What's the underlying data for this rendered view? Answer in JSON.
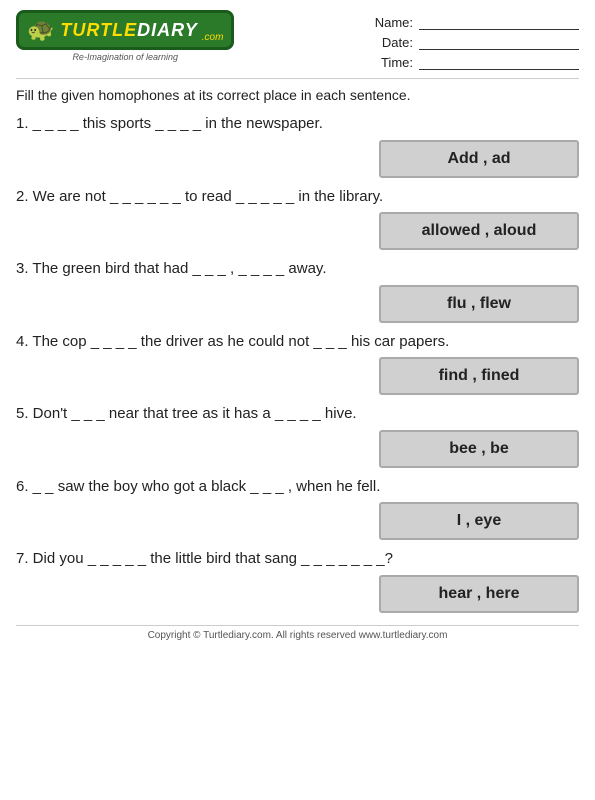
{
  "header": {
    "logo_turtle": "TURTLE",
    "logo_diary": "DIARY",
    "logo_com": ".com",
    "tagline": "Re-Imagination of learning",
    "name_label": "Name:",
    "date_label": "Date:",
    "time_label": "Time:"
  },
  "instructions": "Fill the given homophones at its correct place in each sentence.",
  "questions": [
    {
      "number": "1.",
      "text": "_ _ _ _ this sports _ _ _ _ in the newspaper.",
      "answer": "Add , ad"
    },
    {
      "number": "2.",
      "text": "We are not _ _ _ _ _ _ to read _ _ _ _ _ in the library.",
      "answer": "allowed , aloud"
    },
    {
      "number": "3.",
      "text": "The green bird that had _ _ _ , _ _ _ _ away.",
      "answer": "flu , flew"
    },
    {
      "number": "4.",
      "text": "The cop _ _ _ _ the driver as he could not _ _ _ his car papers.",
      "answer": "find , fined"
    },
    {
      "number": "5.",
      "text": "Don't _ _ _ near that tree as it has a _ _ _ _ hive.",
      "answer": "bee , be"
    },
    {
      "number": "6.",
      "text": "_ _ saw the boy who got a black _ _ _ , when he fell.",
      "answer": "I , eye"
    },
    {
      "number": "7.",
      "text": "Did you _ _ _ _ _ the little bird that sang _ _ _ _ _ _ _?",
      "answer": "hear , here"
    }
  ],
  "footer": "Copyright © Turtlediary.com. All rights reserved  www.turtlediary.com"
}
